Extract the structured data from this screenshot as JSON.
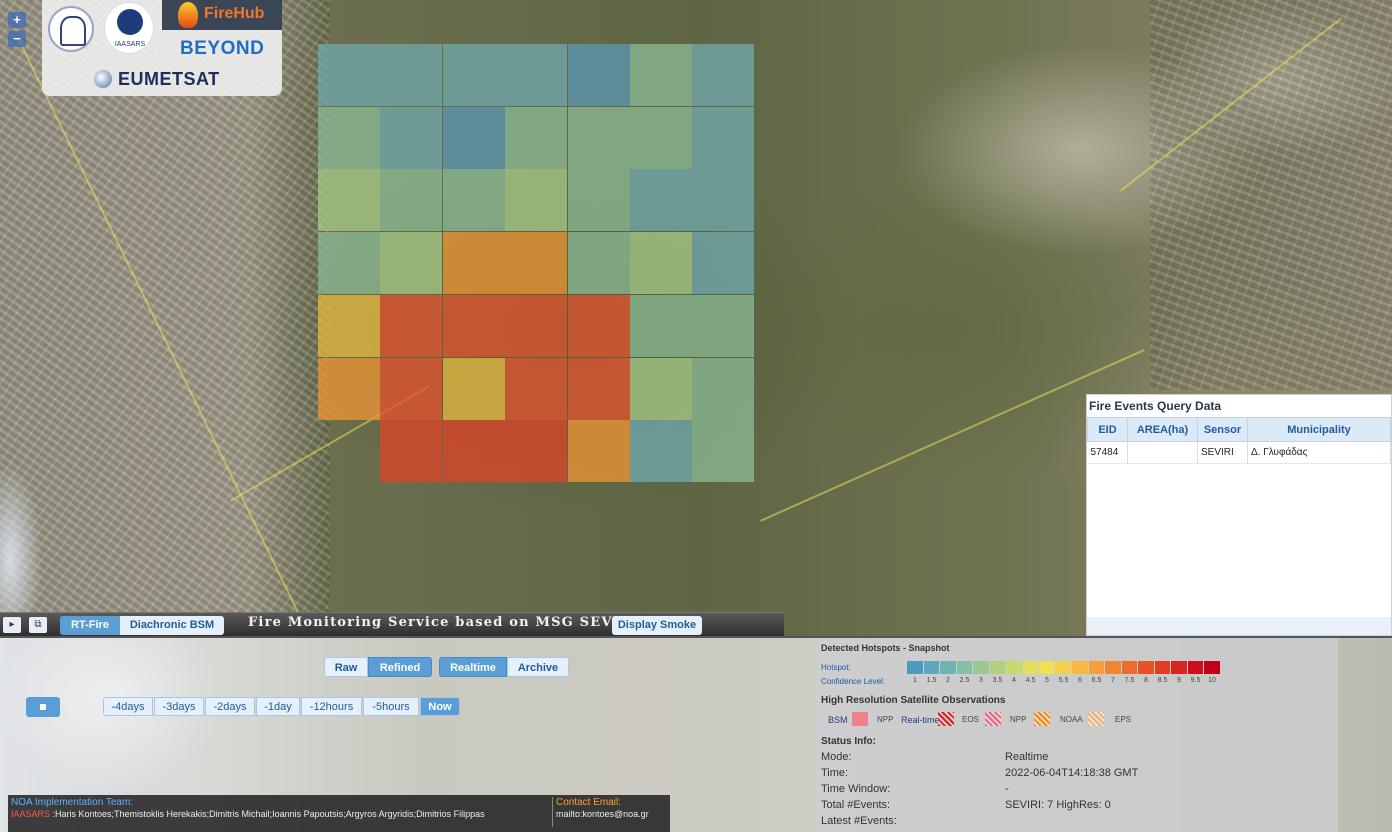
{
  "logos": {
    "iaasars": "IAASARS",
    "firehub": "FireHub",
    "beyond": "BEYOND",
    "eumetsat": "EUMETSAT"
  },
  "zoom": {
    "in": "+",
    "out": "−"
  },
  "heatmap": {
    "colors": {
      "c1": "#5b96b2",
      "c2": "#6fa8ac",
      "c3": "#8ab893",
      "c4": "#a6c886",
      "c5": "#e3b840",
      "c6": "#ec9535",
      "c7": "#e2552e",
      "c8": "#dd4428"
    },
    "cells": [
      [
        "c2",
        "c2",
        "c2",
        "c2",
        "c1",
        "c3",
        "c2"
      ],
      [
        "c3",
        "c2",
        "c1",
        "c3",
        "c3",
        "c3",
        "c2"
      ],
      [
        "c4",
        "c3",
        "c3",
        "c4",
        "c3",
        "c2",
        "c2"
      ],
      [
        "c3",
        "c4",
        "c6",
        "c6",
        "c3",
        "c4",
        "c2"
      ],
      [
        "c5",
        "c7",
        "c7",
        "c7",
        "c7",
        "c3",
        "c3"
      ],
      [
        "c6",
        "c7",
        "c5",
        "c7",
        "c7",
        "c4",
        "c3"
      ],
      [
        "",
        "c8",
        "c8",
        "c8",
        "c6",
        "c2",
        "c3"
      ]
    ]
  },
  "events_panel": {
    "title": "Fire Events Query Data",
    "columns": [
      "EID",
      "AREA(ha)",
      "Sensor",
      "Municipality"
    ],
    "rows": [
      [
        "57484",
        "",
        "SEVIRI",
        "Δ. Γλυφάδας"
      ]
    ]
  },
  "toolbar": {
    "tab_rt_fire": "RT-Fire",
    "tab_diachronic": "Diachronic BSM",
    "service_title": "Fire Monitoring Service based on MSG SEVIRI",
    "display_smoke": "Display Smoke"
  },
  "controls": {
    "raw": "Raw",
    "refined": "Refined",
    "realtime": "Realtime",
    "archive": "Archive",
    "time_buttons": [
      "-4days",
      "-3days",
      "-2days",
      "-1day",
      "-12hours",
      "-5hours",
      "Now"
    ]
  },
  "credits": {
    "team_label": "NOA Implementation Team:",
    "iaasars": "IAASARS",
    "members": " :Haris Kontoes;Themistoklis Herekakis;Dimitris Michail;Ioannis Papoutsis;Argyros Argyridis;Dimitrios Filippas",
    "email_label": "Contact Email:",
    "email": "mailto:kontoes@noa.gr"
  },
  "legend": {
    "snapshot_title": "Detected Hotspots - Snapshot",
    "hotspot_label": "Hotspot:",
    "confidence_label": "Confidence Level:",
    "scale_colors": [
      "#4c9bbf",
      "#5ea7bc",
      "#71b3b4",
      "#85bfa6",
      "#9ac996",
      "#b1d17f",
      "#c9d86c",
      "#e1df5c",
      "#f1e052",
      "#f5cf4a",
      "#f6b842",
      "#f49f3a",
      "#f08633",
      "#ec6c2d",
      "#e75328",
      "#e23c23",
      "#d92520",
      "#cc0f1d",
      "#c0001a"
    ],
    "scale_numbers": [
      "1",
      "1.5",
      "2",
      "2.5",
      "3",
      "3.5",
      "4",
      "4.5",
      "5",
      "5.5",
      "6",
      "6.5",
      "7",
      "7.5",
      "8",
      "8.5",
      "9",
      "9.5",
      "10"
    ],
    "hr_title": "High Resolution Satellite Observations",
    "bsm": "BSM",
    "npp": "NPP",
    "realtime": "Real-time",
    "eos": "EOS",
    "npp2": "NPP",
    "noaa": "NOAA",
    "eps": "EPS",
    "status_title": "Status Info:",
    "status": [
      {
        "key": "Mode:",
        "value": "Realtime"
      },
      {
        "key": "Time:",
        "value": "2022-06-04T14:18:38 GMT"
      },
      {
        "key": "Time Window:",
        "value": "-"
      },
      {
        "key": "Total #Events:",
        "value": "SEVIRI: 7  HighRes: 0"
      },
      {
        "key": "Latest #Events:",
        "value": ""
      }
    ]
  }
}
